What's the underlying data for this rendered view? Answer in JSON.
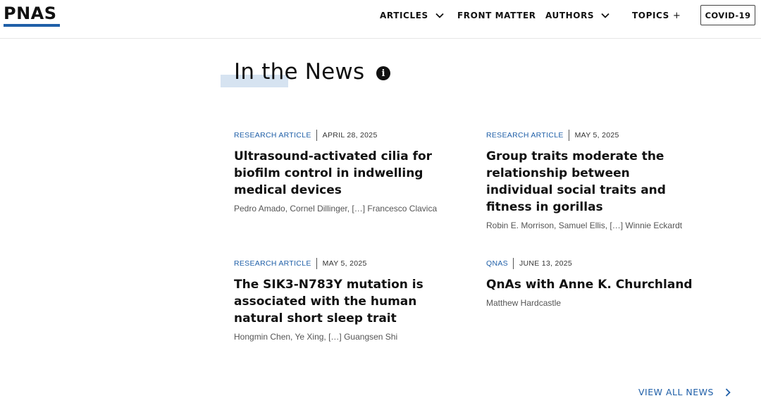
{
  "header": {
    "logo": "PNAS",
    "nav": [
      {
        "label": "ARTICLES",
        "icon": "chevron-down-icon"
      },
      {
        "label": "FRONT MATTER"
      },
      {
        "label": "AUTHORS",
        "icon": "chevron-down-icon"
      },
      {
        "label": "TOPICS",
        "suffix": "+"
      }
    ],
    "covid_label": "COVID-19"
  },
  "section": {
    "title": "In the News",
    "info_glyph": "i"
  },
  "articles": [
    {
      "type": "RESEARCH ARTICLE",
      "date": "APRIL 28, 2025",
      "title": "Ultrasound-activated cilia for biofilm control in indwelling medical devices",
      "authors": "Pedro Amado, Cornel Dillinger, […] Francesco Clavica"
    },
    {
      "type": "RESEARCH ARTICLE",
      "date": "MAY 5, 2025",
      "title": "Group traits moderate the relationship between individual social traits and fitness in gorillas",
      "authors": "Robin E. Morrison, Samuel Ellis, […] Winnie Eckardt"
    },
    {
      "type": "RESEARCH ARTICLE",
      "date": "MAY 5, 2025",
      "title": "The SIK3-N783Y mutation is associated with the human natural short sleep trait",
      "authors": "Hongmin Chen, Ye Xing, […] Guangsen Shi"
    },
    {
      "type": "QNAS",
      "date": "JUNE 13, 2025",
      "title": "QnAs with Anne K. Churchland",
      "authors": "Matthew Hardcastle"
    }
  ],
  "footer": {
    "view_all": "VIEW ALL NEWS"
  },
  "colors": {
    "accent": "#1f5fa8",
    "highlight": "#d6e3f1",
    "text": "#111111",
    "muted": "#555555"
  }
}
